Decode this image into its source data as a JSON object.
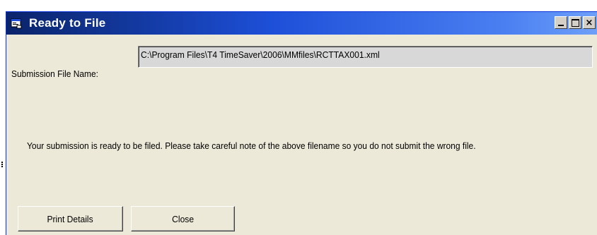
{
  "window": {
    "title": "Ready to File",
    "icon": "app-window-icon",
    "controls": {
      "minimize": "minimize-icon",
      "maximize": "maximize-icon",
      "close": "×"
    }
  },
  "form": {
    "file_label": "Submission File Name:",
    "file_value": "C:\\Program Files\\T4 TimeSaver\\2006\\MMfiles\\RCTTAX001.xml",
    "message": "Your submission is ready to be filed.  Please take careful note of the above filename so you do not submit the wrong file."
  },
  "buttons": {
    "print_label": "Print Details",
    "close_label": "Close"
  },
  "colors": {
    "titlebar_start": "#0a246a",
    "titlebar_end": "#6fa0f8",
    "window_bg": "#ece9d8",
    "field_bg": "#d8d8d8"
  }
}
